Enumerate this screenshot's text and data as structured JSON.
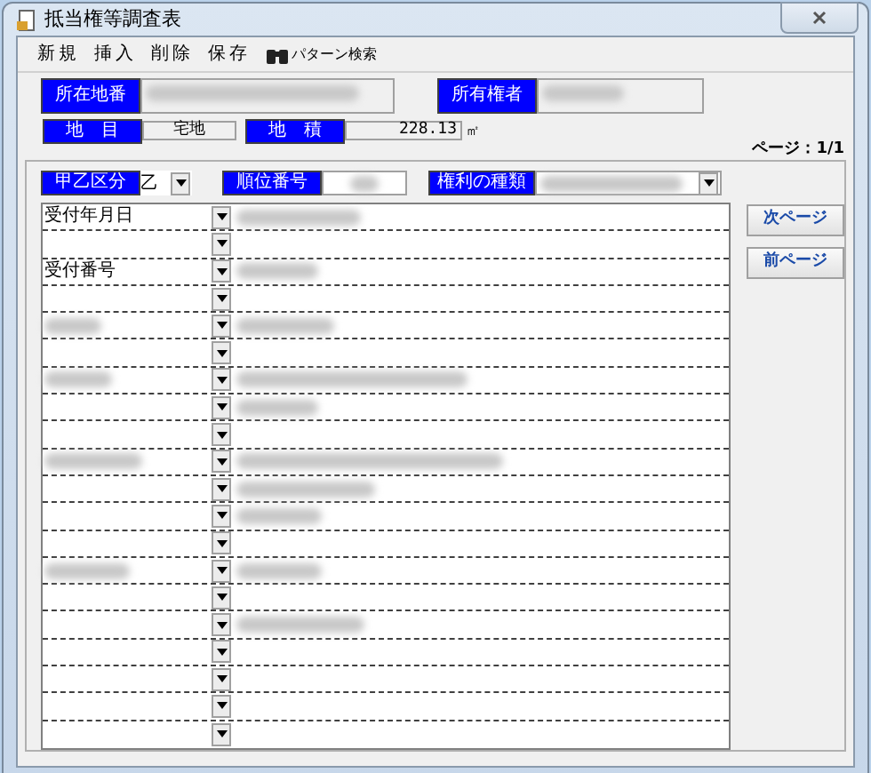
{
  "window": {
    "title": "抵当権等調査表"
  },
  "toolbar": [
    {
      "label": "新規",
      "kind": "text"
    },
    {
      "label": "挿入",
      "kind": "text"
    },
    {
      "label": "削除",
      "kind": "text"
    },
    {
      "label": "保存",
      "kind": "text"
    },
    {
      "label": "パターン検索",
      "kind": "binoculars"
    }
  ],
  "location": {
    "label": "所在地番",
    "value_redacted": true
  },
  "owner": {
    "label": "所有権者",
    "value_redacted": true
  },
  "land_category": {
    "label": "地　目",
    "value": "宅地"
  },
  "land_area": {
    "label": "地　積",
    "value": "228.13",
    "unit": "㎡"
  },
  "page": "ページ：1/1",
  "section": {
    "label": "甲乙区分",
    "value": "乙"
  },
  "rank": {
    "label": "順位番号",
    "value_redacted": true
  },
  "right_type": {
    "label": "権利の種類",
    "value_redacted": true
  },
  "rows": [
    {
      "label": "受付年月日",
      "value_redacted": true
    },
    {
      "value_redacted": false
    },
    {
      "label": "受付番号",
      "value_redacted": true
    },
    {
      "value_redacted": false
    },
    {
      "label_redacted": true,
      "value_redacted": true
    },
    {
      "value_redacted": false
    },
    {
      "label_redacted": true,
      "value_redacted": true
    },
    {
      "value_redacted": true
    },
    {
      "value_redacted": false
    },
    {
      "label_redacted": true,
      "value_redacted": true
    },
    {
      "value_redacted": true
    },
    {
      "value_redacted": true
    },
    {
      "value_redacted": false
    },
    {
      "label_redacted": true,
      "value_redacted": true
    },
    {
      "value_redacted": false
    },
    {
      "value_redacted": true
    },
    {
      "value_redacted": false
    },
    {
      "value_redacted": false
    },
    {
      "value_redacted": false
    },
    {
      "value_redacted": false
    }
  ],
  "buttons": [
    "次ページ",
    "前ページ"
  ]
}
